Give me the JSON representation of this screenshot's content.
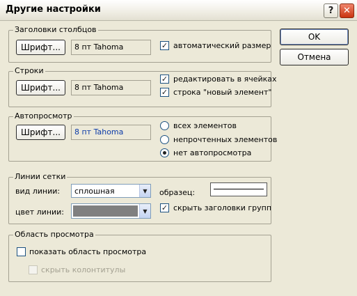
{
  "window": {
    "title": "Другие настройки",
    "help_icon": "help-icon",
    "close_icon": "close-icon"
  },
  "buttons": {
    "ok": "OK",
    "cancel": "Отмена"
  },
  "column_headers": {
    "legend": "Заголовки столбцов",
    "font_button": "Шрифт...",
    "font_value": "8 пт Tahoma",
    "auto_size": {
      "label": "автоматический размер",
      "checked": true
    }
  },
  "rows": {
    "legend": "Строки",
    "font_button": "Шрифт...",
    "font_value": "8 пт Tahoma",
    "edit_in_cells": {
      "label": "редактировать в ячейках",
      "checked": true
    },
    "new_item_row": {
      "label": "строка \"новый элемент\"",
      "checked": true
    }
  },
  "autopreview": {
    "legend": "Автопросмотр",
    "font_button": "Шрифт...",
    "font_value": "8 пт Tahoma",
    "font_value_color": "#0b3aa8",
    "options": [
      {
        "label": "всех элементов",
        "selected": false
      },
      {
        "label": "непрочтенных элементов",
        "selected": false
      },
      {
        "label": "нет автопросмотра",
        "selected": true
      }
    ]
  },
  "grid_lines": {
    "legend": "Линии сетки",
    "line_style_label": "вид линии:",
    "line_style_value": "сплошная",
    "line_color_label": "цвет линии:",
    "line_color_value": "#808080",
    "sample_label": "образец:",
    "hide_group_headers": {
      "label": "скрыть заголовки групп",
      "checked": true
    }
  },
  "reading_pane": {
    "legend": "Область просмотра",
    "show_pane": {
      "label": "показать область просмотра",
      "checked": false
    },
    "hide_header_footer": {
      "label": "скрыть колонтитулы",
      "checked": false,
      "disabled": true
    }
  }
}
